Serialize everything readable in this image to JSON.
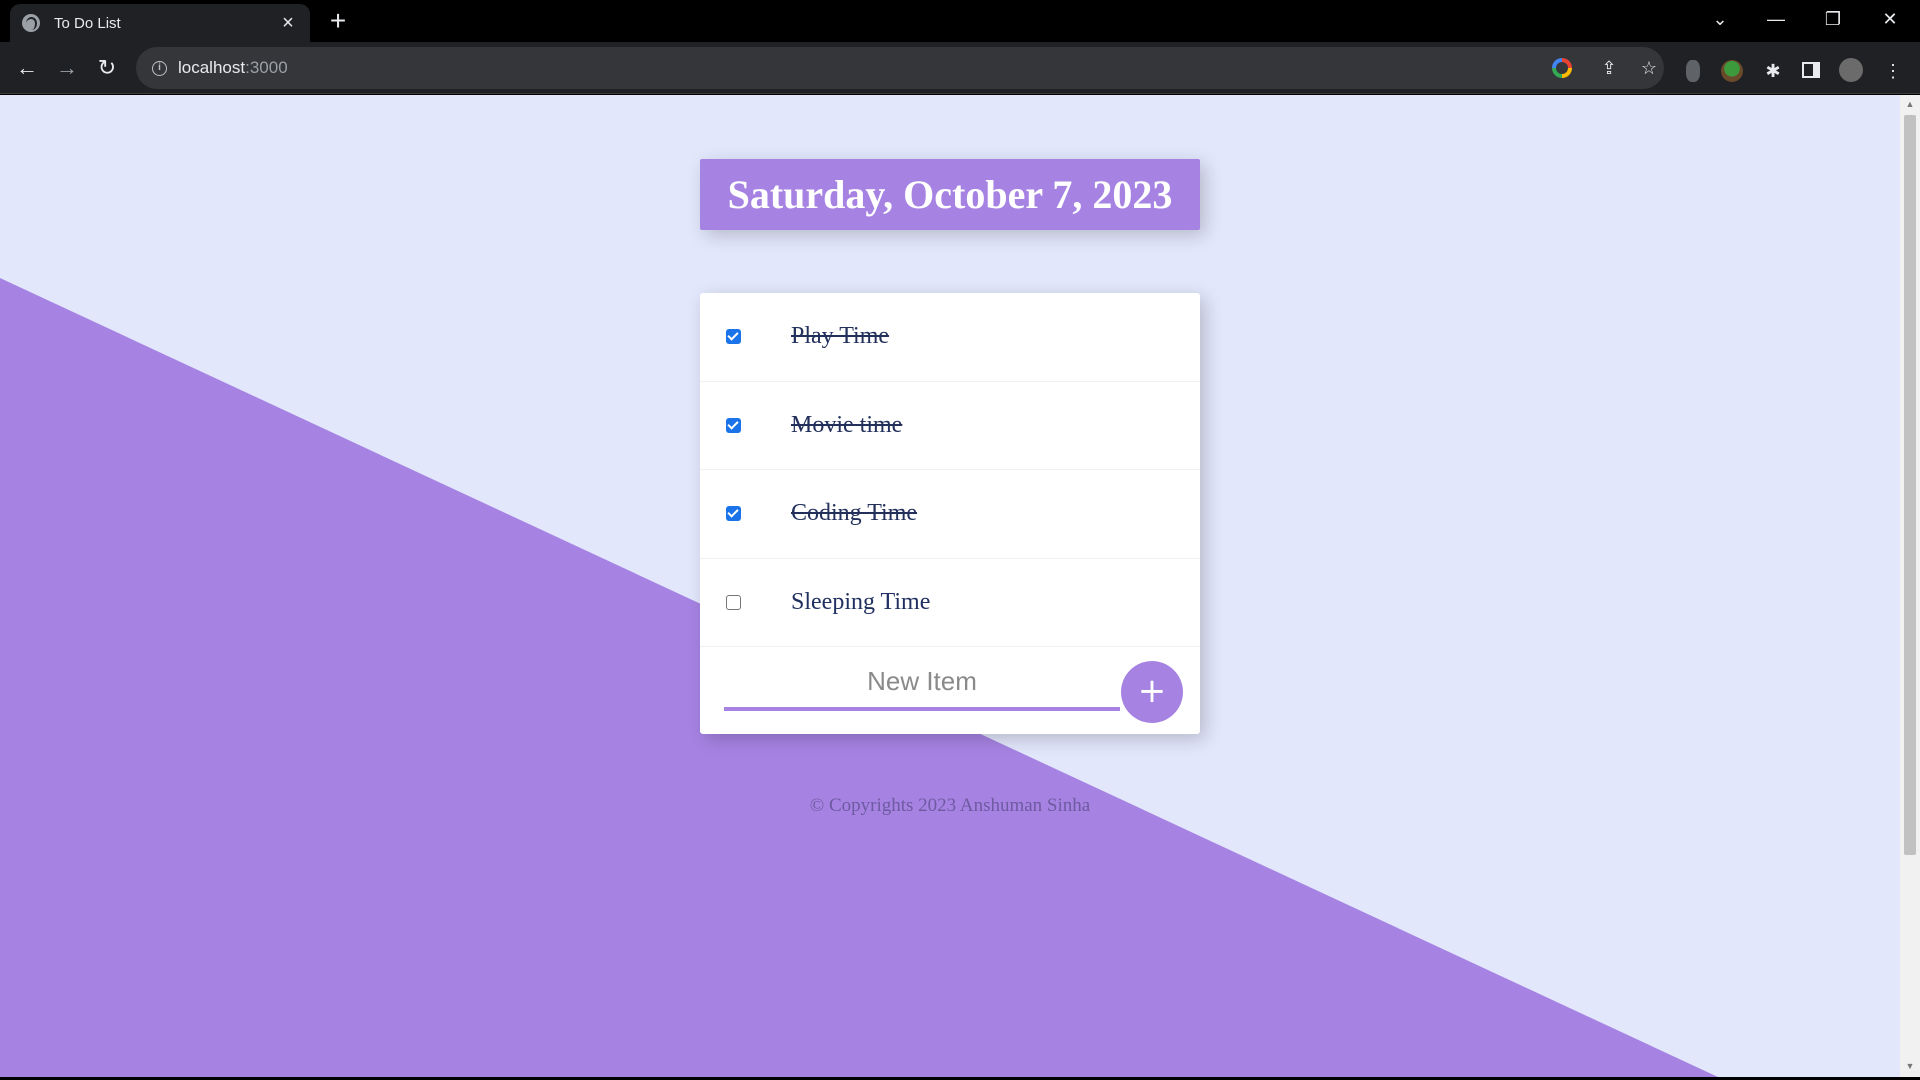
{
  "browser": {
    "tab_title": "To Do List",
    "url_host": "localhost",
    "url_port": ":3000"
  },
  "page": {
    "date_heading": "Saturday, October 7, 2023",
    "items": [
      {
        "label": "Play Time",
        "checked": true
      },
      {
        "label": "Movie time",
        "checked": true
      },
      {
        "label": "Coding Time",
        "checked": true
      },
      {
        "label": "Sleeping Time",
        "checked": false
      }
    ],
    "new_item_placeholder": "New Item",
    "add_label": "+",
    "footer": "© Copyrights 2023 Anshuman Sinha"
  },
  "colors": {
    "accent": "#a683e3",
    "background": "#e2e7fb",
    "checkbox": "#1a73e8",
    "item_text": "#203060"
  },
  "icons": {
    "tab_favicon": "globe-icon",
    "close": "close-icon",
    "new_tab": "plus-icon",
    "back": "arrow-left-icon",
    "forward": "arrow-right-icon",
    "reload": "reload-icon",
    "info": "info-icon",
    "share": "share-icon",
    "bookmark": "star-icon",
    "extensions": "puzzle-icon",
    "sidepanel": "sidepanel-icon",
    "menu": "kebab-menu-icon"
  }
}
